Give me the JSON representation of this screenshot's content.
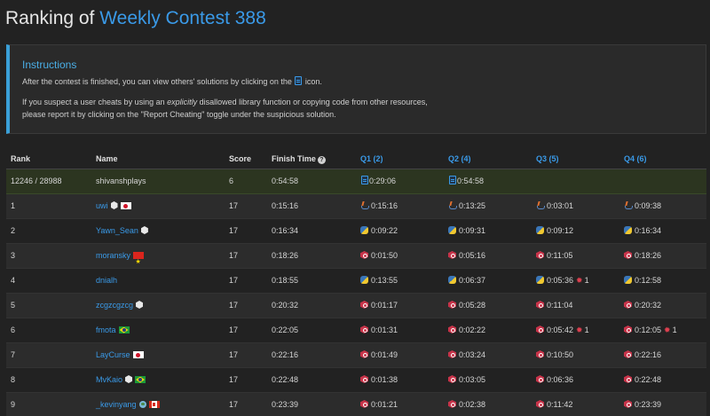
{
  "page": {
    "title_prefix": "Ranking of ",
    "contest_name": "Weekly Contest 388"
  },
  "instructions": {
    "title": "Instructions",
    "line1_before": "After the contest is finished, you can view others' solutions by clicking on the ",
    "line1_after": " icon.",
    "line2_before": "If you suspect a user cheats by using an ",
    "line2_em": "explicitly",
    "line2_after": " disallowed library function or copying code from other resources,",
    "line3": "please report it by clicking on the \"Report Cheating\" toggle under the suspicious solution."
  },
  "table": {
    "headers": {
      "rank": "Rank",
      "name": "Name",
      "score": "Score",
      "finish_time": "Finish Time",
      "q1": "Q1 (2)",
      "q2": "Q2 (4)",
      "q3": "Q3 (5)",
      "q4": "Q4 (6)"
    },
    "my_row": {
      "rank": "12246 / 28988",
      "name": "shivanshplays",
      "score": "6",
      "finish_time": "0:54:58",
      "q1": "0:29:06",
      "q2": "0:54:58"
    },
    "rows": [
      {
        "rank": "1",
        "name": "uwi",
        "score": "17",
        "finish_time": "0:15:16",
        "q1": "0:15:16",
        "q2": "0:13:25",
        "q3": "0:03:01",
        "q4": "0:09:38",
        "lang": "java",
        "badges": [
          "hex",
          "flag-jp"
        ],
        "q3_penalty": "",
        "q4_penalty": ""
      },
      {
        "rank": "2",
        "name": "Yawn_Sean",
        "score": "17",
        "finish_time": "0:16:34",
        "q1": "0:09:22",
        "q2": "0:09:31",
        "q3": "0:09:12",
        "q4": "0:16:34",
        "lang": "py",
        "badges": [
          "hex"
        ],
        "q3_penalty": "",
        "q4_penalty": ""
      },
      {
        "rank": "3",
        "name": "moransky",
        "score": "17",
        "finish_time": "0:18:26",
        "q1": "0:01:50",
        "q2": "0:05:16",
        "q3": "0:11:05",
        "q4": "0:18:26",
        "lang": "cpp",
        "badges": [
          "flag-vn"
        ],
        "q3_penalty": "",
        "q4_penalty": ""
      },
      {
        "rank": "4",
        "name": "dnialh",
        "score": "17",
        "finish_time": "0:18:55",
        "q1": "0:13:55",
        "q2": "0:06:37",
        "q3": "0:05:36",
        "q4": "0:12:58",
        "lang": "py",
        "badges": [],
        "q3_penalty": "1",
        "q4_penalty": ""
      },
      {
        "rank": "5",
        "name": "zcgzcgzcg",
        "score": "17",
        "finish_time": "0:20:32",
        "q1": "0:01:17",
        "q2": "0:05:28",
        "q3": "0:11:04",
        "q4": "0:20:32",
        "lang": "cpp",
        "badges": [
          "hex"
        ],
        "q3_penalty": "",
        "q4_penalty": ""
      },
      {
        "rank": "6",
        "name": "fmota",
        "score": "17",
        "finish_time": "0:22:05",
        "q1": "0:01:31",
        "q2": "0:02:22",
        "q3": "0:05:42",
        "q4": "0:12:05",
        "lang": "cpp",
        "badges": [
          "flag-br"
        ],
        "q3_penalty": "1",
        "q4_penalty": "1"
      },
      {
        "rank": "7",
        "name": "LayCurse",
        "score": "17",
        "finish_time": "0:22:16",
        "q1": "0:01:49",
        "q2": "0:03:24",
        "q3": "0:10:50",
        "q4": "0:22:16",
        "lang": "cpp",
        "badges": [
          "flag-jp"
        ],
        "q3_penalty": "",
        "q4_penalty": ""
      },
      {
        "rank": "8",
        "name": "MvKaio",
        "score": "17",
        "finish_time": "0:22:48",
        "q1": "0:01:38",
        "q2": "0:03:05",
        "q3": "0:06:36",
        "q4": "0:22:48",
        "lang": "cpp",
        "badges": [
          "hex",
          "flag-br"
        ],
        "q3_penalty": "",
        "q4_penalty": ""
      },
      {
        "rank": "9",
        "name": "_kevinyang",
        "score": "17",
        "finish_time": "0:23:39",
        "q1": "0:01:21",
        "q2": "0:02:38",
        "q3": "0:11:42",
        "q4": "0:23:39",
        "lang": "cpp",
        "badges": [
          "globe",
          "flag-ca"
        ],
        "q3_penalty": "",
        "q4_penalty": ""
      }
    ]
  },
  "colors": {
    "accent": "#3a9ae8",
    "instructions_border": "#3aa0d8",
    "my_row_bg": "#2c3520",
    "penalty_icon": "#e04050"
  },
  "icons": {
    "solution": "document-icon",
    "info": "info-icon",
    "penalty": "bug-icon",
    "languages": [
      "java-icon",
      "python-icon",
      "cpp-icon"
    ]
  }
}
